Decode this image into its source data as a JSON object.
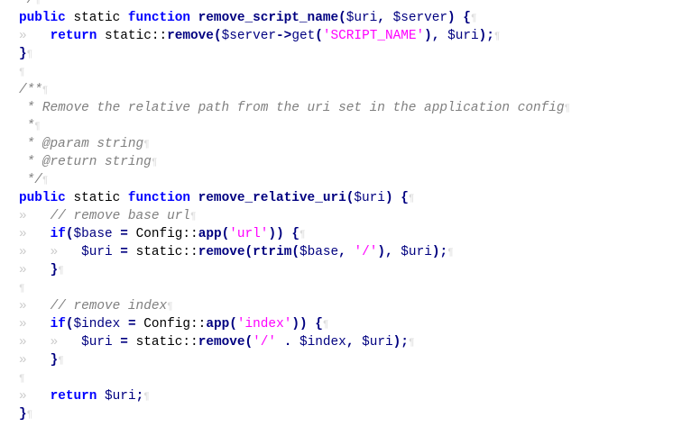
{
  "editor": {
    "pilcrow": "¶",
    "lines": [
      {
        "segments": [
          {
            "t": "*/",
            "c": "cmt"
          }
        ]
      },
      {
        "segments": [
          {
            "t": "public",
            "c": "kw"
          },
          {
            "t": " static ",
            "c": "plain"
          },
          {
            "t": "function",
            "c": "kw"
          },
          {
            "t": " ",
            "c": "plain"
          },
          {
            "t": "remove_script_name",
            "c": "fn"
          },
          {
            "t": "(",
            "c": "op"
          },
          {
            "t": "$uri",
            "c": "var"
          },
          {
            "t": ", ",
            "c": "op"
          },
          {
            "t": "$server",
            "c": "var"
          },
          {
            "t": ") {",
            "c": "op"
          }
        ]
      },
      {
        "segments": [
          {
            "t": "»",
            "c": "ws"
          },
          {
            "t": "   ",
            "c": "plain"
          },
          {
            "t": "return",
            "c": "kw"
          },
          {
            "t": " static::",
            "c": "plain"
          },
          {
            "t": "remove",
            "c": "fn"
          },
          {
            "t": "(",
            "c": "op"
          },
          {
            "t": "$server",
            "c": "var"
          },
          {
            "t": "->",
            "c": "op"
          },
          {
            "t": "get",
            "c": "var"
          },
          {
            "t": "(",
            "c": "op"
          },
          {
            "t": "'SCRIPT_NAME'",
            "c": "str"
          },
          {
            "t": "), ",
            "c": "op"
          },
          {
            "t": "$uri",
            "c": "var"
          },
          {
            "t": ");",
            "c": "op"
          }
        ]
      },
      {
        "segments": [
          {
            "t": "}",
            "c": "op"
          }
        ]
      },
      {
        "segments": []
      },
      {
        "segments": [
          {
            "t": "/**",
            "c": "cmt"
          }
        ]
      },
      {
        "segments": [
          {
            "t": " * Remove the relative path from the uri set in the application config",
            "c": "cmt"
          }
        ]
      },
      {
        "segments": [
          {
            "t": " *",
            "c": "cmt"
          }
        ]
      },
      {
        "segments": [
          {
            "t": " * @param string",
            "c": "cmt"
          }
        ]
      },
      {
        "segments": [
          {
            "t": " * @return string",
            "c": "cmt"
          }
        ]
      },
      {
        "segments": [
          {
            "t": " */",
            "c": "cmt"
          }
        ]
      },
      {
        "segments": [
          {
            "t": "public",
            "c": "kw"
          },
          {
            "t": " static ",
            "c": "plain"
          },
          {
            "t": "function",
            "c": "kw"
          },
          {
            "t": " ",
            "c": "plain"
          },
          {
            "t": "remove_relative_uri",
            "c": "fn"
          },
          {
            "t": "(",
            "c": "op"
          },
          {
            "t": "$uri",
            "c": "var"
          },
          {
            "t": ") {",
            "c": "op"
          }
        ]
      },
      {
        "segments": [
          {
            "t": "»",
            "c": "ws"
          },
          {
            "t": "   ",
            "c": "plain"
          },
          {
            "t": "// remove base url",
            "c": "cmt"
          }
        ]
      },
      {
        "segments": [
          {
            "t": "»",
            "c": "ws"
          },
          {
            "t": "   ",
            "c": "plain"
          },
          {
            "t": "if",
            "c": "kw"
          },
          {
            "t": "(",
            "c": "op"
          },
          {
            "t": "$base",
            "c": "var"
          },
          {
            "t": " = ",
            "c": "op"
          },
          {
            "t": "Config::",
            "c": "plain"
          },
          {
            "t": "app",
            "c": "fn"
          },
          {
            "t": "(",
            "c": "op"
          },
          {
            "t": "'url'",
            "c": "str"
          },
          {
            "t": ")) {",
            "c": "op"
          }
        ]
      },
      {
        "segments": [
          {
            "t": "»",
            "c": "ws"
          },
          {
            "t": "   ",
            "c": "plain"
          },
          {
            "t": "»",
            "c": "ws"
          },
          {
            "t": "   ",
            "c": "plain"
          },
          {
            "t": "$uri",
            "c": "var"
          },
          {
            "t": " = ",
            "c": "op"
          },
          {
            "t": "static::",
            "c": "plain"
          },
          {
            "t": "remove",
            "c": "fn"
          },
          {
            "t": "(",
            "c": "op"
          },
          {
            "t": "rtrim",
            "c": "fn"
          },
          {
            "t": "(",
            "c": "op"
          },
          {
            "t": "$base",
            "c": "var"
          },
          {
            "t": ", ",
            "c": "op"
          },
          {
            "t": "'/'",
            "c": "str"
          },
          {
            "t": "), ",
            "c": "op"
          },
          {
            "t": "$uri",
            "c": "var"
          },
          {
            "t": ");",
            "c": "op"
          }
        ]
      },
      {
        "segments": [
          {
            "t": "»",
            "c": "ws"
          },
          {
            "t": "   ",
            "c": "plain"
          },
          {
            "t": "}",
            "c": "op"
          }
        ]
      },
      {
        "segments": []
      },
      {
        "segments": [
          {
            "t": "»",
            "c": "ws"
          },
          {
            "t": "   ",
            "c": "plain"
          },
          {
            "t": "// remove index",
            "c": "cmt"
          }
        ]
      },
      {
        "segments": [
          {
            "t": "»",
            "c": "ws"
          },
          {
            "t": "   ",
            "c": "plain"
          },
          {
            "t": "if",
            "c": "kw"
          },
          {
            "t": "(",
            "c": "op"
          },
          {
            "t": "$index",
            "c": "var"
          },
          {
            "t": " = ",
            "c": "op"
          },
          {
            "t": "Config::",
            "c": "plain"
          },
          {
            "t": "app",
            "c": "fn"
          },
          {
            "t": "(",
            "c": "op"
          },
          {
            "t": "'index'",
            "c": "str"
          },
          {
            "t": ")) {",
            "c": "op"
          }
        ]
      },
      {
        "segments": [
          {
            "t": "»",
            "c": "ws"
          },
          {
            "t": "   ",
            "c": "plain"
          },
          {
            "t": "»",
            "c": "ws"
          },
          {
            "t": "   ",
            "c": "plain"
          },
          {
            "t": "$uri",
            "c": "var"
          },
          {
            "t": " = ",
            "c": "op"
          },
          {
            "t": "static::",
            "c": "plain"
          },
          {
            "t": "remove",
            "c": "fn"
          },
          {
            "t": "(",
            "c": "op"
          },
          {
            "t": "'/'",
            "c": "str"
          },
          {
            "t": " . ",
            "c": "op"
          },
          {
            "t": "$index",
            "c": "var"
          },
          {
            "t": ", ",
            "c": "op"
          },
          {
            "t": "$uri",
            "c": "var"
          },
          {
            "t": ");",
            "c": "op"
          }
        ]
      },
      {
        "segments": [
          {
            "t": "»",
            "c": "ws"
          },
          {
            "t": "   ",
            "c": "plain"
          },
          {
            "t": "}",
            "c": "op"
          }
        ]
      },
      {
        "segments": []
      },
      {
        "segments": [
          {
            "t": "»",
            "c": "ws"
          },
          {
            "t": "   ",
            "c": "plain"
          },
          {
            "t": "return",
            "c": "kw"
          },
          {
            "t": " ",
            "c": "plain"
          },
          {
            "t": "$uri",
            "c": "var"
          },
          {
            "t": ";",
            "c": "op"
          }
        ]
      },
      {
        "segments": [
          {
            "t": "}",
            "c": "op"
          }
        ]
      }
    ]
  }
}
